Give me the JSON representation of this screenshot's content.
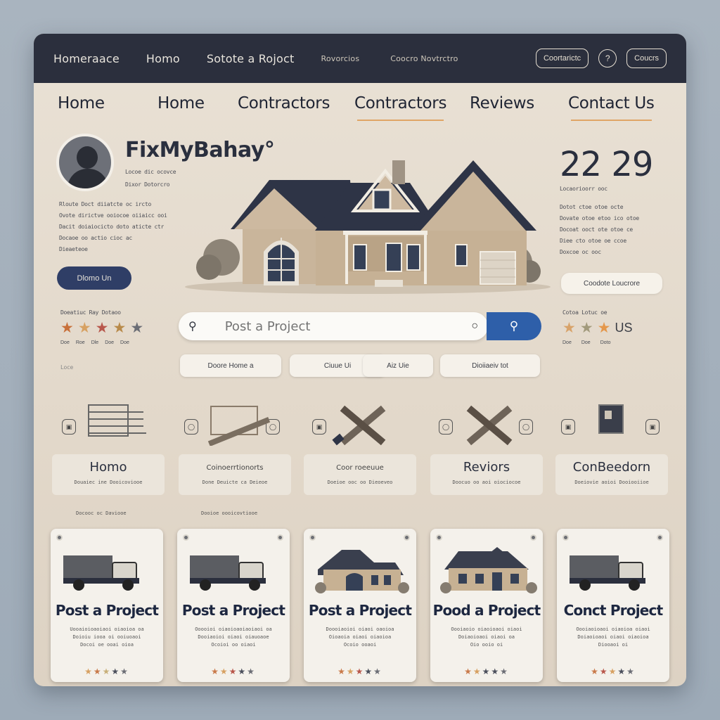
{
  "topbar": {
    "links": [
      "Homeraace",
      "Homo",
      "Sotote a Rojoct"
    ],
    "small_links": [
      "Rovorcios",
      "Coocro Novtrctro"
    ],
    "button_right": "Coortarictc",
    "icon_button": "?",
    "button_small": "Coucrs"
  },
  "nav": {
    "items": [
      {
        "label": "Home",
        "active": false
      },
      {
        "label": "Home",
        "active": false
      },
      {
        "label": "Contractors",
        "active": false
      },
      {
        "label": "Contractors",
        "active": true
      },
      {
        "label": "Reviews",
        "active": false
      },
      {
        "label": "Contact Us",
        "active": true
      }
    ]
  },
  "hero": {
    "brand": "FixMyBahay°",
    "sub1": "Locoe dic ocovce",
    "sub2": "Dixor Dotorcro",
    "desc_lines": [
      "Rloute Doct diiatcte oc ircto",
      "Ovote dirictve ooiocoe oiiaicc ooi",
      "Dacit doiaiocicto doto aticte ctr",
      "Docaoe oo actio cioc ac",
      "Dieaeteoe"
    ],
    "primary_button": "Dlomo Un",
    "stat": "22 29",
    "stat_label": "Locaorioorr ooc",
    "stat_lines": [
      "Dotot ctoe otoe octe",
      "Dovate otoe etoo ico otoe",
      "Docoat ooct ote otoe ce",
      "Diee cto otoe oe ccoe",
      "Doxcoe oc ooc"
    ],
    "secondary_button": "Coodote Loucrore"
  },
  "ratings_left": {
    "title": "Doeatiuc Ray Dotaoo",
    "stars": [
      "#c8703a",
      "#d7a162",
      "#b8574b",
      "#b88a4a",
      "#6b6d75"
    ],
    "labels": [
      "Doe",
      "Roe",
      "Dle",
      "Doe",
      "Doe"
    ],
    "foot": "Loce"
  },
  "ratings_right": {
    "title": "Cotoa Lotuc oe",
    "stars": [
      "#d8a36a",
      "#a29a7c",
      "#e4974b"
    ],
    "extra": "US",
    "labels": [
      "Doe",
      "Doe",
      "Doto"
    ]
  },
  "search": {
    "placeholder": "Post a Project",
    "value": "Post a Project"
  },
  "chips": [
    "Doore   Home a",
    "Ciuue Ui",
    "Aiz Uie",
    "Dioiiaeiv tot"
  ],
  "categories": [
    {
      "label": "Homo",
      "sub": "Douaiec ine Dooicoviooe",
      "small": false
    },
    {
      "label": "Coinoerrtionorts",
      "sub": "Done Deuicte ca Deieoe",
      "small": true
    },
    {
      "label": "Coor roeeuue",
      "sub": "Doeioe ooc oo Dieoeveo",
      "small": true
    },
    {
      "label": "Reviors",
      "sub": "Doocuo oo aoi oiociocoe",
      "small": false
    },
    {
      "label": "ConBeedorn",
      "sub": "Doeiovie aoioi Dooiooiioe",
      "small": false
    }
  ],
  "captions": [
    "Docooc oc Daviooe",
    "Dooioe oooicovtiooe"
  ],
  "cards": [
    {
      "title": "Post a Project",
      "image": "truck",
      "desc": "Uooaioioaoiaoi oiaoioa oa\nDoioiu iooa oi ooiuoaoi\nDocoi oe ooai oioa",
      "stars": [
        "#d7a162",
        "#c97a4a",
        "#c8b07a",
        "#4b4f5c",
        "#6b6d75"
      ]
    },
    {
      "title": "Post a Project",
      "image": "truck",
      "desc": "Ooooioi oiaoioaoiaoiaoi oa\nDooiaoioi oiaoi oiauoaoe\nOcoioi oo oiaoi",
      "stars": [
        "#c97a4a",
        "#d7a162",
        "#b8574b",
        "#4b4f5c",
        "#6b6d75"
      ]
    },
    {
      "title": "Post a Project",
      "image": "house",
      "desc": "Doooiaoioi oiaoi oaoioa\nOioaoia oiaoi oiaoioa\nOcoio ooaoi",
      "stars": [
        "#c97a4a",
        "#d7a162",
        "#b8574b",
        "#4b4f5c",
        "#6b6d75"
      ]
    },
    {
      "title": "Pood a Project",
      "image": "house",
      "desc": "Oooiaoio oiaoioaoi oiaoi\nDoiaoioaoi oiaoi oa\nOio ooio oi",
      "stars": [
        "#c97a4a",
        "#d7a162",
        "#4b4f5c",
        "#4b4f5c",
        "#6b6d75"
      ]
    },
    {
      "title": "Conct Project",
      "image": "truck",
      "desc": "Oooiaoioaoi oiaoioa oiaoi\nDoiaoioaoi oiaoi oiaoioa\nDiooaoi oi",
      "stars": [
        "#c97a4a",
        "#b8574b",
        "#d7a162",
        "#4b4f5c",
        "#6b6d75"
      ]
    }
  ],
  "colors": {
    "topbar": "#2b2f3d",
    "accent_underline": "#e0a566",
    "search_button": "#2e5fa9",
    "primary_button": "#2f3e66",
    "background": "#e6ddd0"
  }
}
